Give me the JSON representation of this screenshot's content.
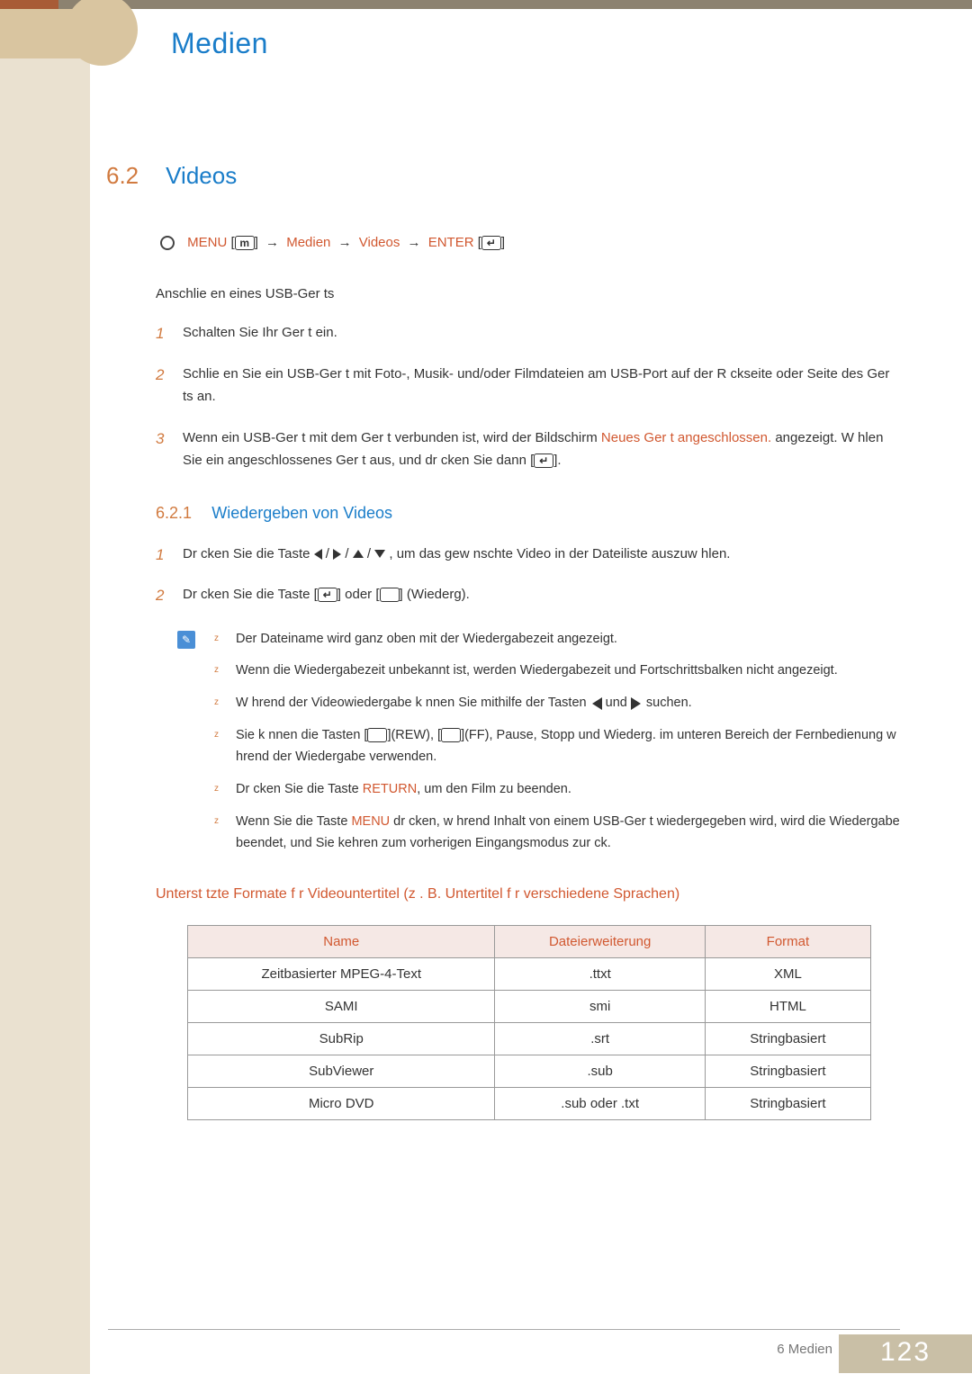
{
  "chapter_title": "Medien",
  "section": {
    "number": "6.2",
    "title": "Videos"
  },
  "nav": {
    "menu": "MENU",
    "m_glyph": "m",
    "item1": "Medien",
    "item2": "Videos",
    "enter": "ENTER"
  },
  "usb_intro": "Anschlie en eines USB-Ger ts",
  "steps_a": [
    {
      "num": "1",
      "text": "Schalten Sie Ihr Ger t ein."
    },
    {
      "num": "2",
      "text": "Schlie en Sie ein USB-Ger t mit Foto-, Musik- und/oder Filmdateien am USB-Port auf der R ckseite oder Seite des Ger ts an."
    },
    {
      "num": "3",
      "pre": "Wenn ein USB-Ger t mit dem Ger t verbunden ist, wird der Bildschirm ",
      "highlight": "Neues Ger t angeschlossen.",
      "post": " angezeigt. W hlen Sie ein angeschlossenes Ger t aus, und dr cken Sie dann [",
      "tail": "]."
    }
  ],
  "subsection": {
    "number": "6.2.1",
    "title": "Wiedergeben von Videos"
  },
  "steps_b": [
    {
      "num": "1",
      "pre": "Dr cken Sie die Taste ",
      "post": ", um das gew nschte Video in der Dateiliste auszuw hlen."
    },
    {
      "num": "2",
      "pre": "Dr cken Sie die Taste [",
      "mid": "] oder [",
      "post": "] (Wiederg)."
    }
  ],
  "notes": [
    "Der Dateiname wird ganz oben mit der Wiedergabezeit angezeigt.",
    "Wenn die Wiedergabezeit unbekannt ist, werden Wiedergabezeit und Fortschrittsbalken nicht angezeigt.",
    {
      "pre": "W hrend der Videowiedergabe k nnen Sie mithilfe der Tasten ",
      "mid": " und ",
      "post": " suchen."
    },
    {
      "pre": "Sie k nnen die Tasten [",
      "mid1": "](REW), [",
      "mid2": "](FF), Pause, Stopp und Wiederg. im unteren Bereich der Fernbedienung w hrend der Wiedergabe verwenden."
    },
    {
      "pre": "Dr cken Sie die Taste ",
      "kw": "RETURN",
      "post": ", um den Film zu beenden."
    },
    {
      "pre": "Wenn Sie die Taste ",
      "kw": "MENU",
      "post": " dr cken, w hrend Inhalt von einem USB-Ger t wiedergegeben wird, wird die Wiedergabe beendet, und Sie kehren zum vorherigen Eingangsmodus zur ck."
    }
  ],
  "subtitle_formats_heading": "Unterst tzte Formate f r Videountertitel (z    . B. Untertitel f r verschiedene Sprachen)",
  "table": {
    "headers": [
      "Name",
      "Dateierweiterung",
      "Format"
    ],
    "rows": [
      [
        "Zeitbasierter MPEG-4-Text",
        ".ttxt",
        "XML"
      ],
      [
        "SAMI",
        "smi",
        "HTML"
      ],
      [
        "SubRip",
        ".srt",
        "Stringbasiert"
      ],
      [
        "SubViewer",
        ".sub",
        "Stringbasiert"
      ],
      [
        "Micro DVD",
        ".sub oder .txt",
        "Stringbasiert"
      ]
    ]
  },
  "footer": {
    "text": "6 Medien",
    "page": "123"
  }
}
